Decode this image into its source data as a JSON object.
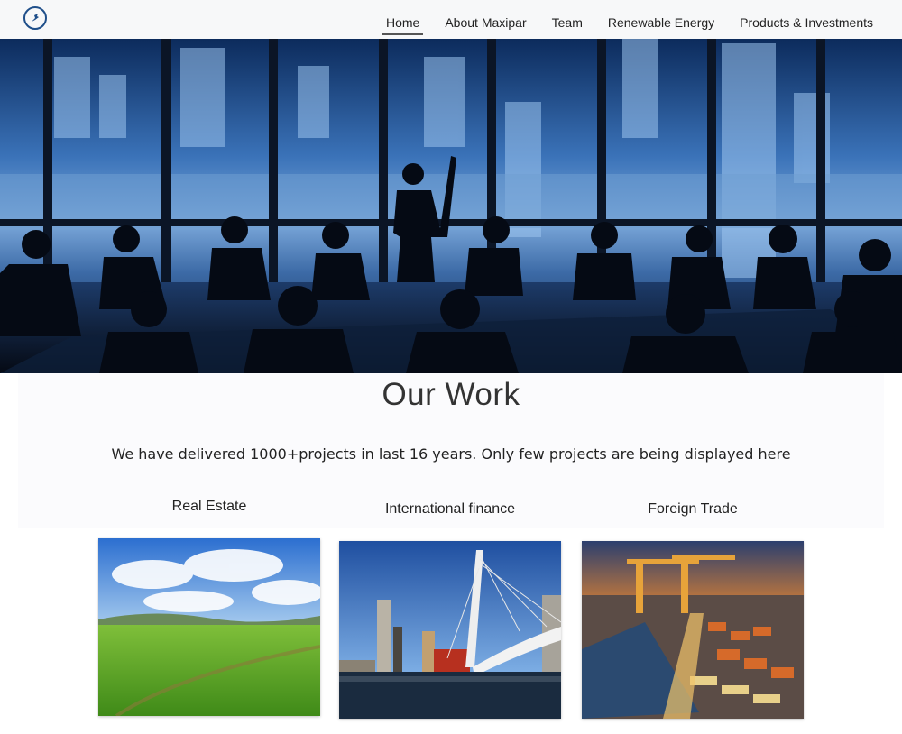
{
  "nav": {
    "logo_icon": "maxipar-logo-icon",
    "items": [
      {
        "label": "Home",
        "active": true
      },
      {
        "label": "About Maxipar",
        "active": false
      },
      {
        "label": "Team",
        "active": false
      },
      {
        "label": "Renewable Energy",
        "active": false
      },
      {
        "label": "Products & Investments",
        "active": false
      }
    ]
  },
  "hero": {
    "image": "boardroom-presentation-city-skyline"
  },
  "our_work": {
    "title": "Our Work",
    "subtitle": "We have delivered 1000+projects in last 16 years. Only few projects are being displayed here",
    "categories": [
      {
        "title": "Real Estate",
        "image": "green-field-blue-sky"
      },
      {
        "title": "International finance",
        "image": "cable-stayed-bridge-city"
      },
      {
        "title": "Foreign Trade",
        "image": "container-port-cranes"
      }
    ]
  },
  "colors": {
    "accent": "#1f4f8a",
    "nav_bg": "#f7f8f9",
    "hero_blue": "#2f63a6"
  }
}
